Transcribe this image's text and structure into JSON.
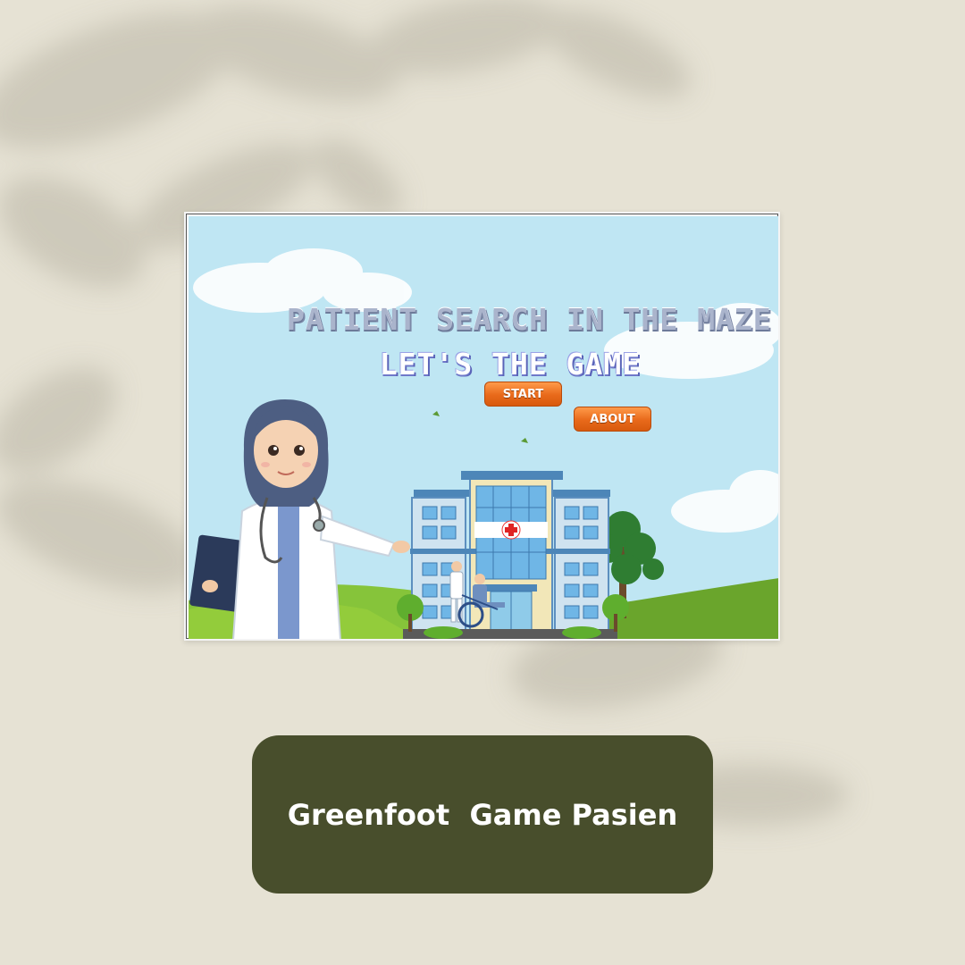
{
  "game": {
    "title": "PATIENT SEARCH IN THE MAZE",
    "subtitle": "LET'S THE GAME",
    "start_label": "START",
    "about_label": "ABOUT"
  },
  "caption": {
    "text": "Greenfoot  Game Pasien"
  },
  "colors": {
    "background": "#e6e2d4",
    "caption_bg": "#484e2c",
    "sky": "#bfe6f3",
    "button": "#e8691a",
    "grass": "#7bbf2a"
  }
}
